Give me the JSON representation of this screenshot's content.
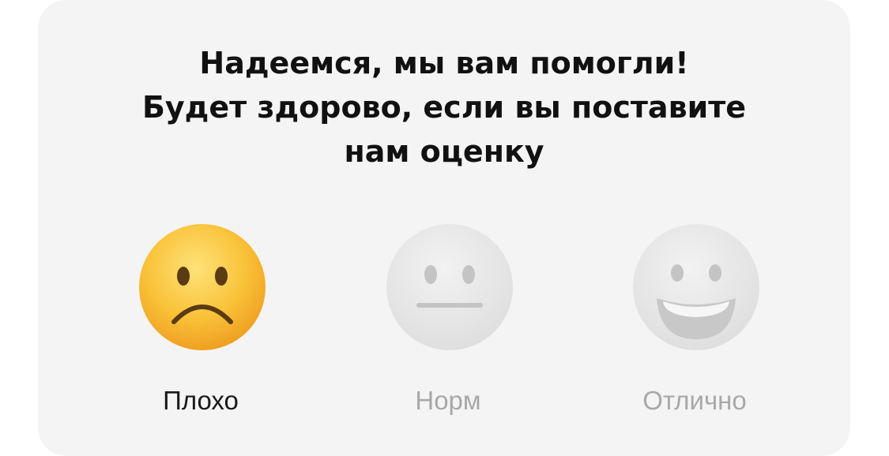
{
  "dialog": {
    "title_lines": [
      "Надеемся, мы вам помогли!",
      "Будет здорово, если вы поставите",
      "нам оценку"
    ]
  },
  "rating": {
    "options": [
      {
        "label": "Плохо",
        "icon": "sad-face-icon",
        "selected": true,
        "label_color": "#1a1a1a"
      },
      {
        "label": "Норм",
        "icon": "neutral-face-icon",
        "selected": false,
        "label_color": "#a8a8a8"
      },
      {
        "label": "Отлично",
        "icon": "happy-face-icon",
        "selected": false,
        "label_color": "#a8a8a8"
      }
    ]
  },
  "colors": {
    "card_background": "#f4f4f4",
    "active_emoji": "#f7b92c",
    "inactive_emoji": "#e6e6e6"
  }
}
